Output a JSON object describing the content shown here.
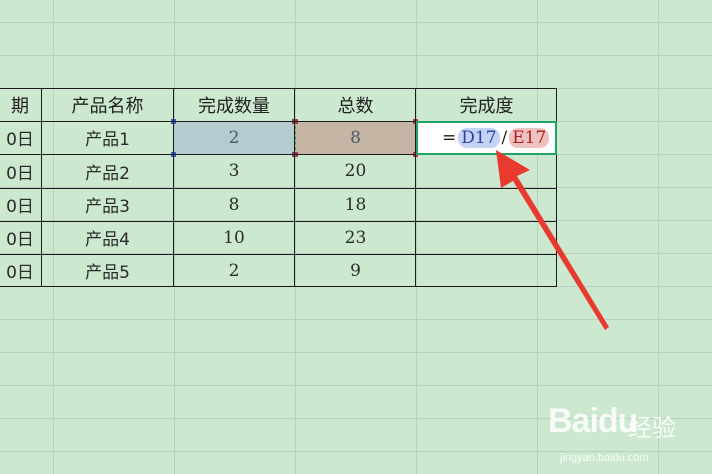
{
  "headers": [
    "期",
    "产品名称",
    "完成数量",
    "总数",
    "完成度"
  ],
  "rows": [
    {
      "date": "0日",
      "product": "产品1",
      "done": "2",
      "total": "8"
    },
    {
      "date": "0日",
      "product": "产品2",
      "done": "3",
      "total": "20"
    },
    {
      "date": "0日",
      "product": "产品3",
      "done": "8",
      "total": "18"
    },
    {
      "date": "0日",
      "product": "产品4",
      "done": "10",
      "total": "23"
    },
    {
      "date": "0日",
      "product": "产品5",
      "done": "2",
      "total": "9"
    }
  ],
  "formula": {
    "equals": "=",
    "ref1": "D17",
    "operator": "/",
    "ref2": "E17"
  },
  "annotation_arrow_color": "#e83a2e",
  "grid_color": "#b9cfc2",
  "sheet_background": "#cce8cf",
  "watermark": {
    "brand": "Baidu",
    "name": "经验",
    "url": "jingyan.baidu.com"
  }
}
